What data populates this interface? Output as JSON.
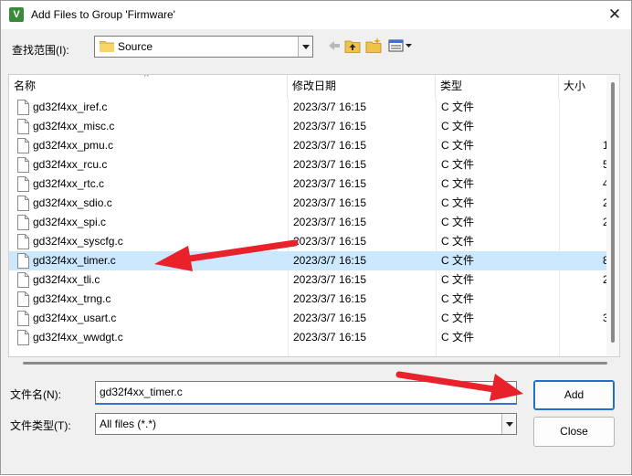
{
  "window": {
    "title": "Add Files to Group 'Firmware'",
    "app_icon_letter": "V",
    "close_glyph": "✕"
  },
  "lookin": {
    "label": "查找范围(I):",
    "value": "Source",
    "toolbar_icons": [
      "back-arrow-icon",
      "up-folder-icon",
      "new-folder-icon",
      "view-menu-icon"
    ]
  },
  "list": {
    "columns": {
      "name": "名称",
      "modified": "修改日期",
      "type": "类型",
      "size": "大小"
    },
    "rows": [
      {
        "name": "gd32f4xx_iref.c",
        "modified": "2023/3/7 16:15",
        "type": "C 文件",
        "size": ""
      },
      {
        "name": "gd32f4xx_misc.c",
        "modified": "2023/3/7 16:15",
        "type": "C 文件",
        "size": ""
      },
      {
        "name": "gd32f4xx_pmu.c",
        "modified": "2023/3/7 16:15",
        "type": "C 文件",
        "size": "1"
      },
      {
        "name": "gd32f4xx_rcu.c",
        "modified": "2023/3/7 16:15",
        "type": "C 文件",
        "size": "5"
      },
      {
        "name": "gd32f4xx_rtc.c",
        "modified": "2023/3/7 16:15",
        "type": "C 文件",
        "size": "4"
      },
      {
        "name": "gd32f4xx_sdio.c",
        "modified": "2023/3/7 16:15",
        "type": "C 文件",
        "size": "2"
      },
      {
        "name": "gd32f4xx_spi.c",
        "modified": "2023/3/7 16:15",
        "type": "C 文件",
        "size": "2"
      },
      {
        "name": "gd32f4xx_syscfg.c",
        "modified": "2023/3/7 16:15",
        "type": "C 文件",
        "size": ""
      },
      {
        "name": "gd32f4xx_timer.c",
        "modified": "2023/3/7 16:15",
        "type": "C 文件",
        "size": "8",
        "selected": true
      },
      {
        "name": "gd32f4xx_tli.c",
        "modified": "2023/3/7 16:15",
        "type": "C 文件",
        "size": "2"
      },
      {
        "name": "gd32f4xx_trng.c",
        "modified": "2023/3/7 16:15",
        "type": "C 文件",
        "size": ""
      },
      {
        "name": "gd32f4xx_usart.c",
        "modified": "2023/3/7 16:15",
        "type": "C 文件",
        "size": "3"
      },
      {
        "name": "gd32f4xx_wwdgt.c",
        "modified": "2023/3/7 16:15",
        "type": "C 文件",
        "size": ""
      }
    ]
  },
  "filename": {
    "label": "文件名(N):",
    "value": "gd32f4xx_timer.c"
  },
  "filetype": {
    "label": "文件类型(T):",
    "value": "All files (*.*)"
  },
  "buttons": {
    "add": "Add",
    "close": "Close"
  },
  "colors": {
    "selection": "#cce8ff",
    "annotation_arrow": "#e8212b",
    "default_button_border": "#1e6fd0"
  }
}
